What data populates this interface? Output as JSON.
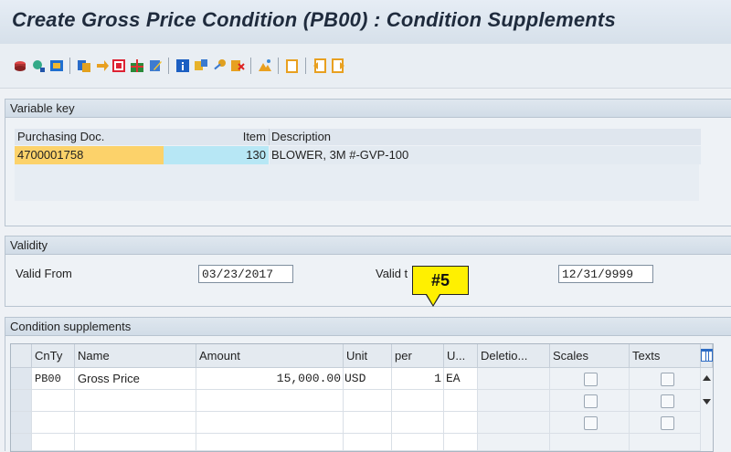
{
  "window": {
    "title": "Create Gross Price Condition (PB00) : Condition Supplements"
  },
  "toolbar": {
    "icons": [
      "scale-icon",
      "condition-info-icon",
      "cost-icon",
      "copy-icon",
      "next-icon",
      "pricing-icon",
      "gift-icon",
      "edit-icon",
      "info-icon",
      "scales-icon",
      "key-icon",
      "deletion-icon",
      "mountain-icon",
      "doc-icon",
      "prev-item-icon",
      "next-item-icon"
    ]
  },
  "variable_key": {
    "header": "Variable key",
    "columns": [
      "Purchasing Doc.",
      "Item",
      "Description"
    ],
    "row": {
      "doc": "4700001758",
      "item": "130",
      "description": "BLOWER, 3M #-GVP-100"
    }
  },
  "validity": {
    "header": "Validity",
    "valid_from_label": "Valid From",
    "valid_from": "03/23/2017",
    "valid_to_label": "Valid t",
    "valid_to": "12/31/9999"
  },
  "callout": {
    "label": "#5"
  },
  "supplements": {
    "header": "Condition supplements",
    "columns": [
      "CnTy",
      "Name",
      "Amount",
      "Unit",
      "per",
      "U...",
      "Deletio...",
      "Scales",
      "Texts"
    ],
    "rows": [
      {
        "cnty": "PB00",
        "name": "Gross Price",
        "amount": "15,000.00",
        "unit": "USD",
        "per": "1",
        "uom": "EA"
      }
    ]
  },
  "colors": {
    "accent": "#fcd26a",
    "item_blue": "#b7e7f5",
    "title": "#1f2b3d"
  }
}
